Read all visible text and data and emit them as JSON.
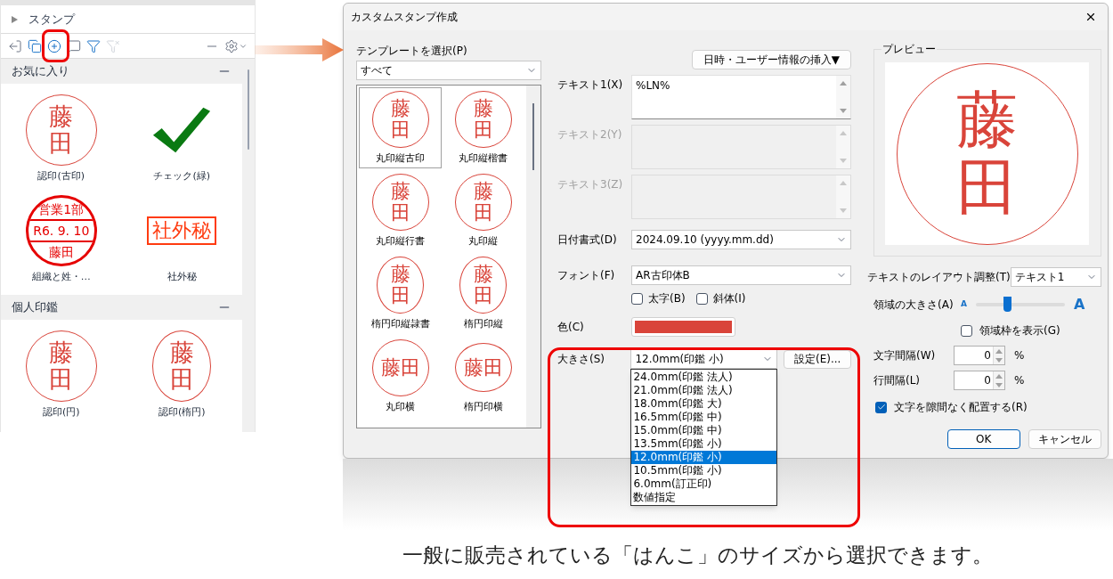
{
  "stamp_panel": {
    "title": "スタンプ",
    "toolbar": [
      {
        "kind": "import",
        "disabled": false
      },
      {
        "kind": "copy",
        "disabled": false
      },
      {
        "kind": "add",
        "disabled": false
      },
      {
        "kind": "comment",
        "disabled": false
      },
      {
        "kind": "filter",
        "disabled": false
      },
      {
        "kind": "clear-filter",
        "disabled": true
      },
      {
        "kind": "collapse",
        "disabled": false
      },
      {
        "kind": "settings",
        "disabled": false
      }
    ],
    "sections": [
      {
        "title": "お気に入り",
        "expanded": true,
        "items": [
          {
            "label": "認印(古印)",
            "stamp": {
              "kind": "round",
              "text": "藤田"
            }
          },
          {
            "label": "チェック(緑)",
            "stamp": {
              "kind": "check"
            }
          },
          {
            "label": "組織と姓・…",
            "stamp": {
              "kind": "dated",
              "lines": [
                "営業1部",
                "R6. 9. 10",
                "藤田"
              ]
            }
          },
          {
            "label": "社外秘",
            "stamp": {
              "kind": "rect",
              "text": "社外秘"
            }
          }
        ]
      },
      {
        "title": "個人印鑑",
        "expanded": true,
        "items": [
          {
            "label": "認印(円)",
            "stamp": {
              "kind": "round",
              "text": "藤田"
            }
          },
          {
            "label": "認印(楕円)",
            "stamp": {
              "kind": "oval",
              "text": "藤田"
            }
          }
        ]
      }
    ]
  },
  "dialog": {
    "title": "カスタムスタンプ作成",
    "template_label": "テンプレートを選択(P)",
    "template_filter": "すべて",
    "templates": [
      {
        "label": "丸印縦古印",
        "selected": true,
        "stamp": {
          "kind": "round",
          "text": "藤田"
        }
      },
      {
        "label": "丸印縦楷書",
        "selected": false,
        "stamp": {
          "kind": "round",
          "text": "藤田"
        }
      },
      {
        "label": "丸印縦行書",
        "selected": false,
        "stamp": {
          "kind": "round",
          "text": "藤田"
        }
      },
      {
        "label": "丸印縦",
        "selected": false,
        "stamp": {
          "kind": "round",
          "text": "藤田"
        }
      },
      {
        "label": "楕円印縦隷書",
        "selected": false,
        "stamp": {
          "kind": "oval",
          "text": "藤田"
        }
      },
      {
        "label": "楕円印縦",
        "selected": false,
        "stamp": {
          "kind": "oval",
          "text": "藤田"
        }
      },
      {
        "label": "丸印横",
        "selected": false,
        "stamp": {
          "kind": "round-h",
          "text": "藤田"
        }
      },
      {
        "label": "楕円印横",
        "selected": false,
        "stamp": {
          "kind": "oval-h",
          "text": "藤田"
        }
      }
    ],
    "insert_button": "日時・ユーザー情報の挿入▼",
    "text_fields": [
      {
        "label": "テキスト1(X)",
        "value": "%LN%",
        "disabled": false
      },
      {
        "label": "テキスト2(Y)",
        "disabled": true
      },
      {
        "label": "テキスト3(Z)",
        "disabled": true
      }
    ],
    "date_format": {
      "label": "日付書式(D)",
      "value": "2024.09.10 (yyyy.mm.dd)"
    },
    "font": {
      "label": "フォント(F)",
      "value": "AR古印体B"
    },
    "styles": [
      {
        "label": "太字(B)",
        "checked": false
      },
      {
        "label": "斜体(I)",
        "checked": false
      }
    ],
    "color": {
      "label": "色(C)",
      "color": "#d9443a"
    },
    "size": {
      "label": "大きさ(S)",
      "value": "12.0mm(印鑑 小)",
      "expanded": true,
      "options": [
        {
          "label": "24.0mm(印鑑 法人)",
          "selected": false
        },
        {
          "label": "21.0mm(印鑑 法人)",
          "selected": false
        },
        {
          "label": "18.0mm(印鑑 大)",
          "selected": false
        },
        {
          "label": "16.5mm(印鑑 中)",
          "selected": false
        },
        {
          "label": "15.0mm(印鑑 中)",
          "selected": false
        },
        {
          "label": "13.5mm(印鑑 小)",
          "selected": false
        },
        {
          "label": "12.0mm(印鑑 小)",
          "selected": true
        },
        {
          "label": "10.5mm(印鑑 小)",
          "selected": false
        },
        {
          "label": "6.0mm(訂正印)",
          "selected": false
        },
        {
          "label": "数値指定",
          "selected": false
        }
      ]
    },
    "settings_button": "設定(E)...",
    "preview": {
      "title": "プレビュー",
      "stamp": {
        "kind": "round",
        "text": "藤田"
      }
    },
    "layout": {
      "label": "テキストのレイアウト調整(T)",
      "value": "テキスト1"
    },
    "area": {
      "label": "領域の大きさ(A)",
      "small": "A",
      "large": "A",
      "level": 0.35
    },
    "show_frame": {
      "label": "領域枠を表示(G)",
      "checked": false
    },
    "spacing": [
      {
        "label": "文字間隔(W)",
        "value": "0",
        "unit": "%"
      },
      {
        "label": "行間隔(L)",
        "value": "0",
        "unit": "%"
      }
    ],
    "pack": {
      "label": "文字を隙間なく配置する(R)",
      "checked": true
    },
    "buttons": [
      {
        "label": "OK",
        "kind": "default"
      },
      {
        "label": "キャンセル",
        "kind": "normal"
      }
    ]
  },
  "caption": "一般に販売されている「はんこ」のサイズから選択できます。"
}
